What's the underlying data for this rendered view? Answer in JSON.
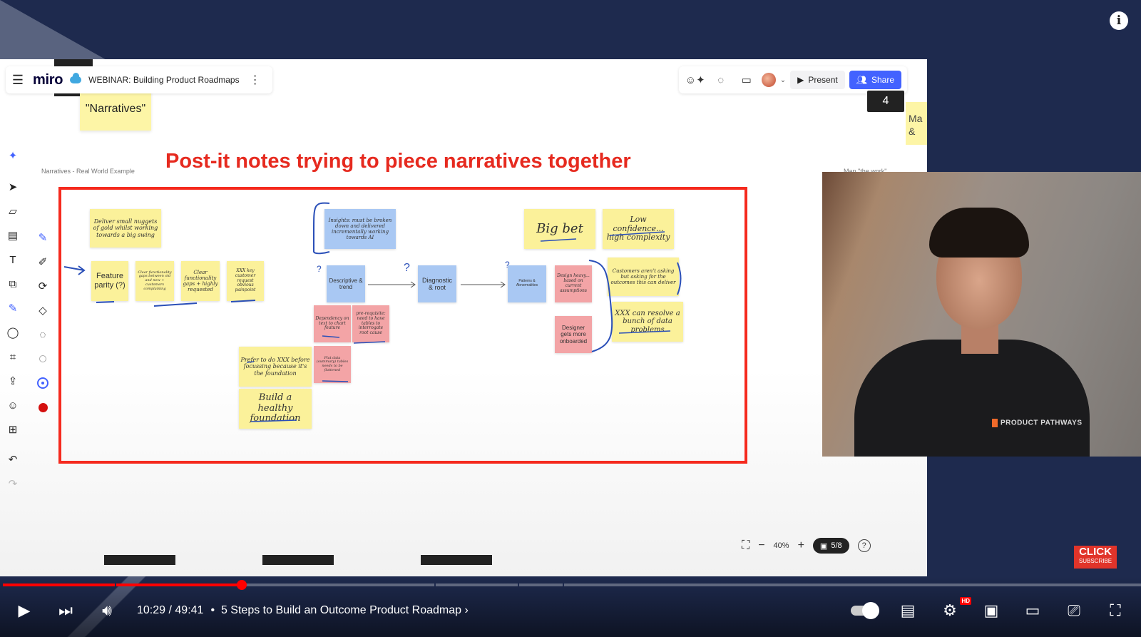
{
  "video": {
    "current_time": "10:29",
    "separator": "/",
    "duration": "49:41",
    "chapter_bullet": "•",
    "chapter_title": "5 Steps to Build an Outcome Product Roadmap",
    "progress_fraction": 0.21,
    "progress_color": "#ff0000",
    "hd_badge": "HD"
  },
  "miro": {
    "logo": "miro",
    "board_title": "WEBINAR: Building Product Roadmaps",
    "present_label": "Present",
    "share_label": "Share",
    "counter": "4",
    "zoom": "40%",
    "pages": "5/8",
    "accent": "#4262ff"
  },
  "canvas": {
    "narratives_note": "\"Narratives\"",
    "frame_label_left": "Narratives - Real World Example",
    "frame_label_right": "Map \"the work\"",
    "right_note_lines": [
      "Ma",
      "&"
    ],
    "headline": "Post-it notes trying to piece narratives together",
    "headline_color": "#e62a1f",
    "notes": {
      "deliver": "Deliver small nuggets of gold whilst working towards a big swing",
      "feature_parity": "Feature parity (?)",
      "clear_gaps": "Clear functionality gaps between old and new + customers complaining",
      "clear_highly": "Clear functionality gaps + highly requested",
      "xxx_key": "XXX key customer request obvious painpoint",
      "insights": "Insights: must be broken down and delivered incrementally working towards AI",
      "descriptive": "Descriptive & trend",
      "diagnostic": "Diagnostic & root",
      "patterns": "Patterns & Abnormalities",
      "dependency": "Dependency on text to chart feature",
      "prerequisite": "pre-requisite: need to have tables to interrogate root cause",
      "flat_data": "Flat data (summary) tables needs to be flattened",
      "prefer": "Prefer to do XXX before focussing because it's the foundation",
      "healthy": "Build a healthy foundation",
      "big_bet": "Big bet",
      "low_conf": "Low confidence... high complexity",
      "design_heavy": "Design heavy... based on current assumptions",
      "designer": "Designer gets more onboarded",
      "customers": "Customers aren't asking but asking for the outcomes this can deliver",
      "xxx_resolve": "XXX can resolve a bunch of data problems"
    },
    "marks": {
      "q1": "?",
      "q2": "?",
      "q3": "?"
    }
  },
  "webcam": {
    "shirt_brand": "PRODUCT PATHWAYS"
  },
  "overlay": {
    "info": "i",
    "subscribe_big": "CLICK",
    "subscribe_small": "SUBSCRIBE"
  }
}
